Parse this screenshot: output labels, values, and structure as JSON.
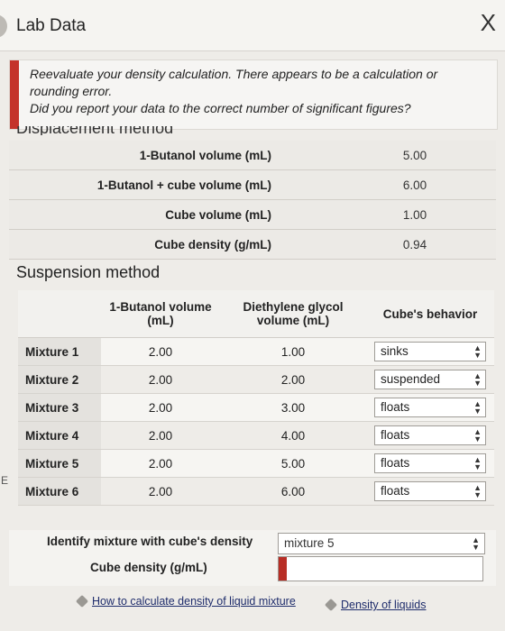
{
  "window": {
    "title": "Lab Data",
    "close_glyph": "X"
  },
  "alert": {
    "line1": "Reevaluate your density calculation. There appears to be a calculation or rounding error.",
    "line2": "Did you report your data to the correct number of significant figures?",
    "accent_color": "#c4332b"
  },
  "displacement": {
    "heading": "Displacement method",
    "rows": [
      {
        "label": "1-Butanol volume (mL)",
        "value": "5.00"
      },
      {
        "label": "1-Butanol + cube volume (mL)",
        "value": "6.00"
      },
      {
        "label": "Cube volume (mL)",
        "value": "1.00"
      },
      {
        "label": "Cube density (g/mL)",
        "value": "0.94"
      }
    ]
  },
  "suspension": {
    "heading": "Suspension method",
    "columns": [
      "1-Butanol volume (mL)",
      "Diethylene glycol volume (mL)",
      "Cube's behavior"
    ],
    "rows": [
      {
        "label": "Mixture 1",
        "butanol": "2.00",
        "glycol": "1.00",
        "behavior": "sinks"
      },
      {
        "label": "Mixture 2",
        "butanol": "2.00",
        "glycol": "2.00",
        "behavior": "suspended"
      },
      {
        "label": "Mixture 3",
        "butanol": "2.00",
        "glycol": "3.00",
        "behavior": "floats"
      },
      {
        "label": "Mixture 4",
        "butanol": "2.00",
        "glycol": "4.00",
        "behavior": "floats"
      },
      {
        "label": "Mixture 5",
        "butanol": "2.00",
        "glycol": "5.00",
        "behavior": "floats"
      },
      {
        "label": "Mixture 6",
        "butanol": "2.00",
        "glycol": "6.00",
        "behavior": "floats"
      }
    ]
  },
  "edge_letter": "E",
  "identify": {
    "label": "Identify mixture with cube's density",
    "selected": "mixture 5",
    "density_label": "Cube density (g/mL)",
    "density_value": ""
  },
  "links": {
    "calc": "How to calculate density of liquid mixture",
    "density": "Density of liquids"
  }
}
